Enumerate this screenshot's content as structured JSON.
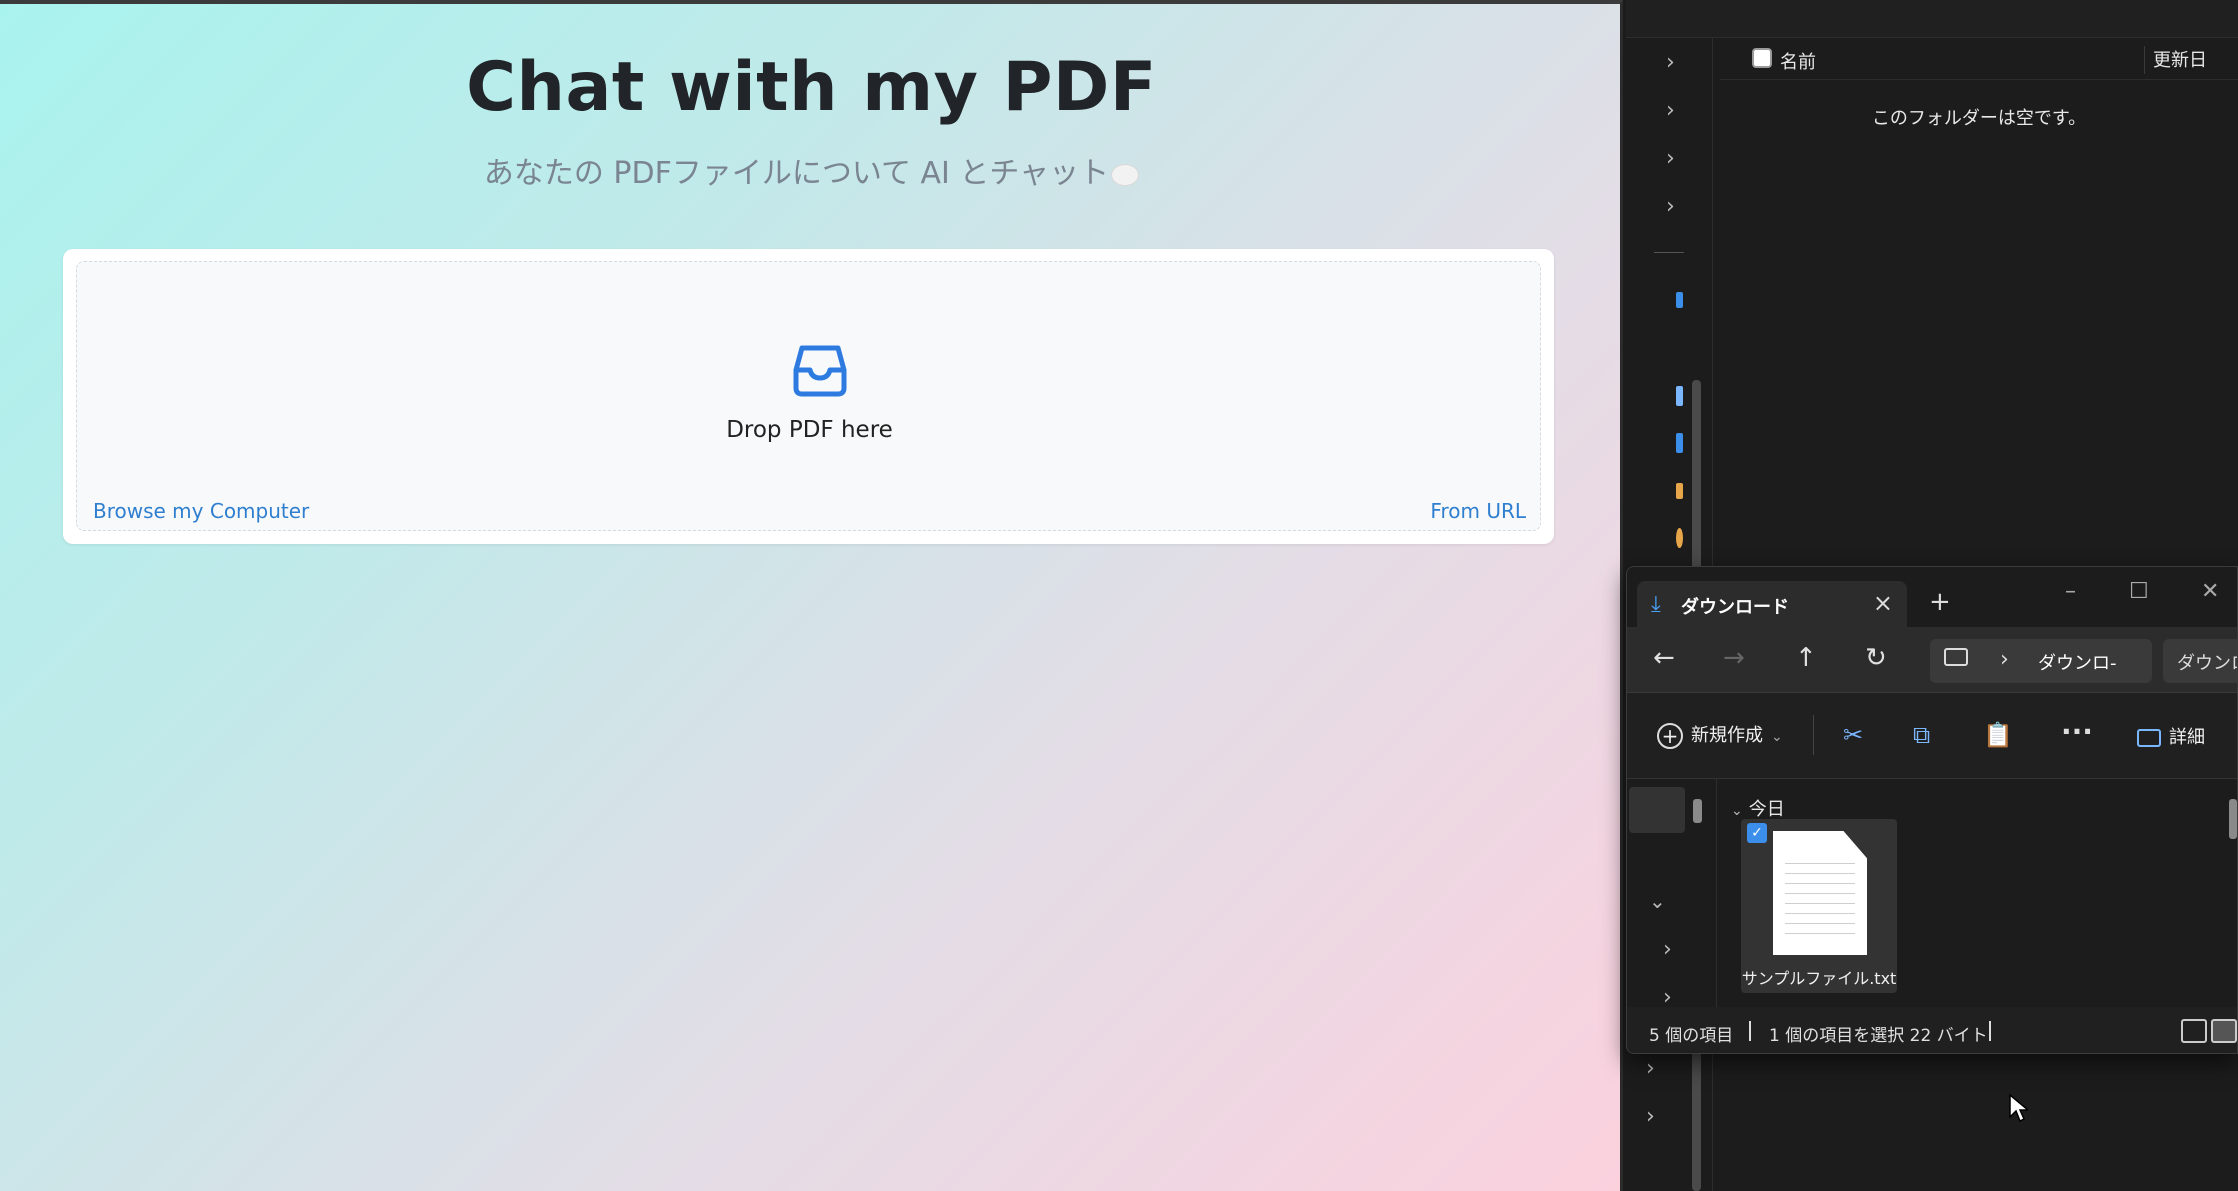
{
  "web": {
    "title": "Chat with my PDF",
    "subtitle": "あなたの PDFファイルについて AI とチャット",
    "drop_label": "Drop PDF here",
    "browse_label": "Browse my Computer",
    "url_label": "From URL",
    "accent_color": "#2f7fd0"
  },
  "bg_explorer": {
    "column_name": "名前",
    "column_date": "更新日",
    "empty_message": "このフォルダーは空です。"
  },
  "explorer": {
    "tab_title": "ダウンロード",
    "breadcrumb": "ダウンロ-",
    "search_placeholder": "ダウンロ",
    "new_label": "新規作成",
    "details_label": "詳細",
    "group_label": "今日",
    "file_name": "サンプルファイル.txt",
    "status_items": "5 個の項目",
    "status_selected": "1 個の項目を選択  22 バイト"
  },
  "icons": {
    "inbox": "inbox-icon",
    "download": "download-icon",
    "close": "close-icon",
    "plus": "plus-icon"
  }
}
